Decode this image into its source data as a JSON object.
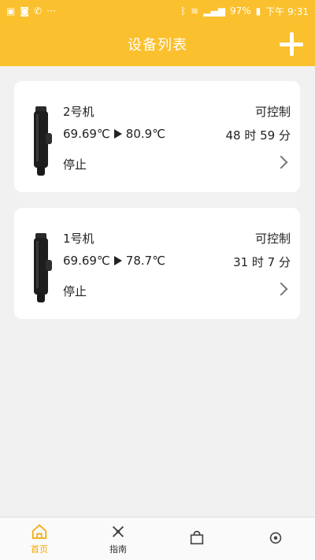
{
  "statusbar": {
    "battery": "97%",
    "time": "下午 9:31",
    "more": "···"
  },
  "header": {
    "title": "设备列表",
    "add_icon": "plus-icon"
  },
  "devices": [
    {
      "name": "2号机",
      "temp_from": "69.69℃",
      "temp_to": "80.9℃",
      "state": "停止",
      "control": "可控制",
      "time": "48 时 59 分"
    },
    {
      "name": "1号机",
      "temp_from": "69.69℃",
      "temp_to": "78.7℃",
      "state": "停止",
      "control": "可控制",
      "time": "31 时 7 分"
    }
  ],
  "bottom_nav": {
    "items": [
      {
        "label": "首页",
        "icon": "home-icon"
      },
      {
        "label": "指南",
        "icon": "guide-icon"
      },
      {
        "label": "",
        "icon": "store-icon"
      },
      {
        "label": "",
        "icon": "settings-icon"
      }
    ]
  },
  "colors": {
    "accent": "#fbc02d",
    "nav_active": "#f2a900",
    "background": "#f1f1f1"
  }
}
